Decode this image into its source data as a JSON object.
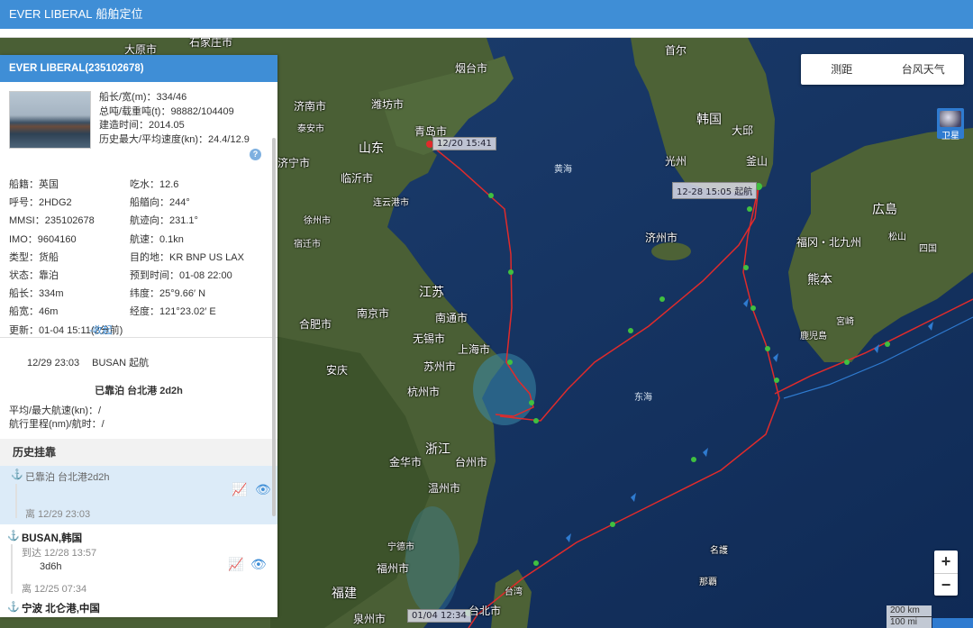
{
  "app": {
    "ship_name": "EVER LIBERAL",
    "title_suffix": "船舶定位"
  },
  "panel": {
    "header": "EVER LIBERAL(235102678)",
    "ship_summary": [
      "船长/宽(m)：334/46",
      "总吨/载重吨(t)：98882/104409",
      "建造时间：2014.05",
      "历史最大/平均速度(kn)：24.4/12.9"
    ],
    "help": "?",
    "details": [
      [
        "船籍：英国",
        "吃水：12.6"
      ],
      [
        "呼号：2HDG2",
        "船艏向：244°"
      ],
      [
        "MMSI：235102678",
        "航迹向：231.1°"
      ],
      [
        "IMO：9604160",
        "航速：0.1kn"
      ],
      [
        "类型：货船",
        "目的地：KR BNP US LAX"
      ],
      [
        "状态：靠泊",
        "预到时间：01-08 22:00"
      ],
      [
        "船长：334m",
        "纬度：25°9.66′ N"
      ],
      [
        "船宽：46m",
        "经度：121°23.02′ E"
      ]
    ],
    "updated": "更新：01-04 15:11(2分前)",
    "collapse": "-收起",
    "departure": {
      "time": "12/29 23:03",
      "port": "BUSAN 起航"
    },
    "status_line": "已靠泊 台北港 2d2h",
    "avg_speed": "平均/最大航速(kn)：/",
    "voyage": "航行里程(nm)/航时：/",
    "history_title": "历史挂靠",
    "history": {
      "current": {
        "label": "已靠泊 台北港2d2h",
        "depart": "离 12/29 23:03"
      },
      "busan": {
        "port": "BUSAN,韩国",
        "arrive": "到达 12/28 13:57",
        "duration": "3d6h",
        "depart": "离 12/25 07:34"
      },
      "ningbo": {
        "port": "宁波 北仑港,中国"
      }
    }
  },
  "map": {
    "tools": [
      "测距",
      "台风天气"
    ],
    "satellite": "卫星",
    "zoom_in": "+",
    "zoom_out": "−",
    "scale": [
      "200 km",
      "100 mi"
    ],
    "track_labels": [
      "12/20 15:41",
      "12-28 15:05 起航",
      "01/04 12:34"
    ],
    "labels": {
      "yantai": "烟台市",
      "dalian_t": "石家庄市",
      "dazhou": "大原市",
      "jinan": "济南市",
      "weifang": "潍坊市",
      "qingdao": "青岛市",
      "taian": "泰安市",
      "shandong": "山东",
      "jining": "济宁市",
      "linyi": "临沂市",
      "lianyungang": "连云港市",
      "xuzhou": "徐州市",
      "suqian": "宿迁市",
      "jiangsu": "江苏",
      "hefei": "合肥市",
      "nanjing": "南京市",
      "nantong": "南通市",
      "wuxi": "无锡市",
      "shanghai": "上海市",
      "suzhou": "苏州市",
      "anqing": "安庆",
      "hangzhou": "杭州市",
      "zhejiang": "浙江",
      "jinhua": "金华市",
      "taizhou": "台州市",
      "wenzhou": "温州市",
      "ningde": "宁德市",
      "fuzhou": "福州市",
      "fujian": "福建",
      "quanzhou": "泉州市",
      "taipei": "台北市",
      "taiwan": "台湾",
      "seoul": "首尔",
      "korea": "韩国",
      "daegu": "大邱",
      "gwangju": "光州",
      "busan": "釜山",
      "jeju": "济州市",
      "hiroshima": "広島",
      "fukuoka": "福冈・北九州",
      "kumamoto": "熊本",
      "kagoshima": "鹿児島",
      "miyazaki": "宮崎",
      "shikoku": "四国",
      "matsuyama": "松山",
      "naha": "那覇",
      "kunigami": "名護",
      "yellow_sea": "黄海",
      "east_sea": "东海"
    }
  }
}
